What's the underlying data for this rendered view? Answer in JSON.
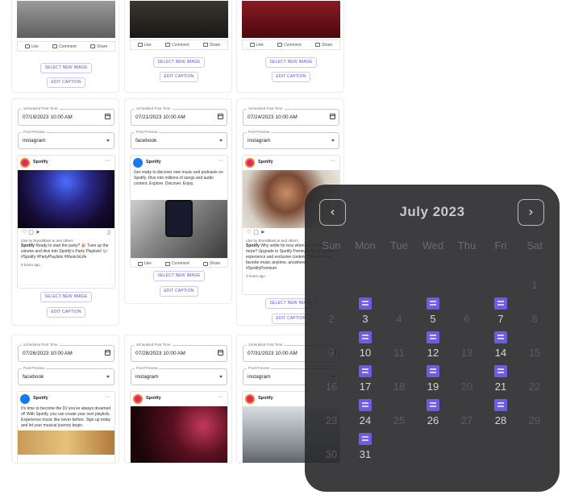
{
  "scheduled_label": "Scheduled Post Time",
  "preview_label": "Post Preview",
  "select_btn": "SELECT NEW IMAGE",
  "edit_btn": "EDIT CAPTION",
  "actions": {
    "like": "Like",
    "comment": "Comment",
    "share": "Share"
  },
  "brand": "Spotify",
  "top_row": [
    {
      "id": "a"
    },
    {
      "id": "b"
    },
    {
      "id": "c"
    }
  ],
  "cards": [
    {
      "time": "07/19/2023 10:00 AM",
      "platform": "instagram",
      "likes": "Like by BrandBlast.ai and others",
      "caption_brand": "Spotify",
      "caption": "Ready to start the party? 🎉 Tune up the volume and dive into Spotify's Party Playlists! 🎶 #Spotify #PartyPlaylists #MusicIsLife",
      "age": "3 hours ago"
    },
    {
      "time": "07/21/2023 10:00 AM",
      "platform": "facebook",
      "caption": "Get ready to discover new music and podcasts on Spotify. Dive into millions of songs and audio content. Explore. Discover. Enjoy."
    },
    {
      "time": "07/24/2023 10:00 AM",
      "platform": "instagram",
      "likes": "Like by BrandBlast.ai and others",
      "caption_brand": "Spotify",
      "caption": "Why settle for less when you can have more? Upgrade to Spotify Premium for an ad-free experience and exclusive content. Tap into your favorite music anytime, anywhere! #SpotifyPremium",
      "age": "3 hours ago"
    },
    {
      "time": "07/26/2023 10:00 AM",
      "platform": "facebook",
      "caption": "It's time to become the DJ you've always dreamed of! With Spotify, you can create your own playlists. Experience music like never before. Sign up today and let your musical journey begin."
    },
    {
      "time": "07/28/2023 10:00 AM",
      "platform": "instagram"
    },
    {
      "time": "07/31/2023 10:00 AM",
      "platform": "instagram"
    }
  ],
  "calendar": {
    "month": "July 2023",
    "prev": "‹",
    "next": "›",
    "weekdays": [
      "Sun",
      "Mon",
      "Tue",
      "Wed",
      "Thu",
      "Fri",
      "Sat"
    ],
    "days": [
      "1",
      "2",
      "3",
      "4",
      "5",
      "6",
      "7",
      "8",
      "9",
      "10",
      "11",
      "12",
      "13",
      "14",
      "15",
      "16",
      "17",
      "18",
      "19",
      "20",
      "21",
      "22",
      "23",
      "24",
      "25",
      "26",
      "27",
      "28",
      "29",
      "30",
      "31"
    ],
    "event_days": [
      "3",
      "5",
      "7",
      "10",
      "12",
      "14",
      "17",
      "19",
      "21",
      "24",
      "26",
      "28",
      "31"
    ],
    "accent": "#6d5ce8"
  }
}
